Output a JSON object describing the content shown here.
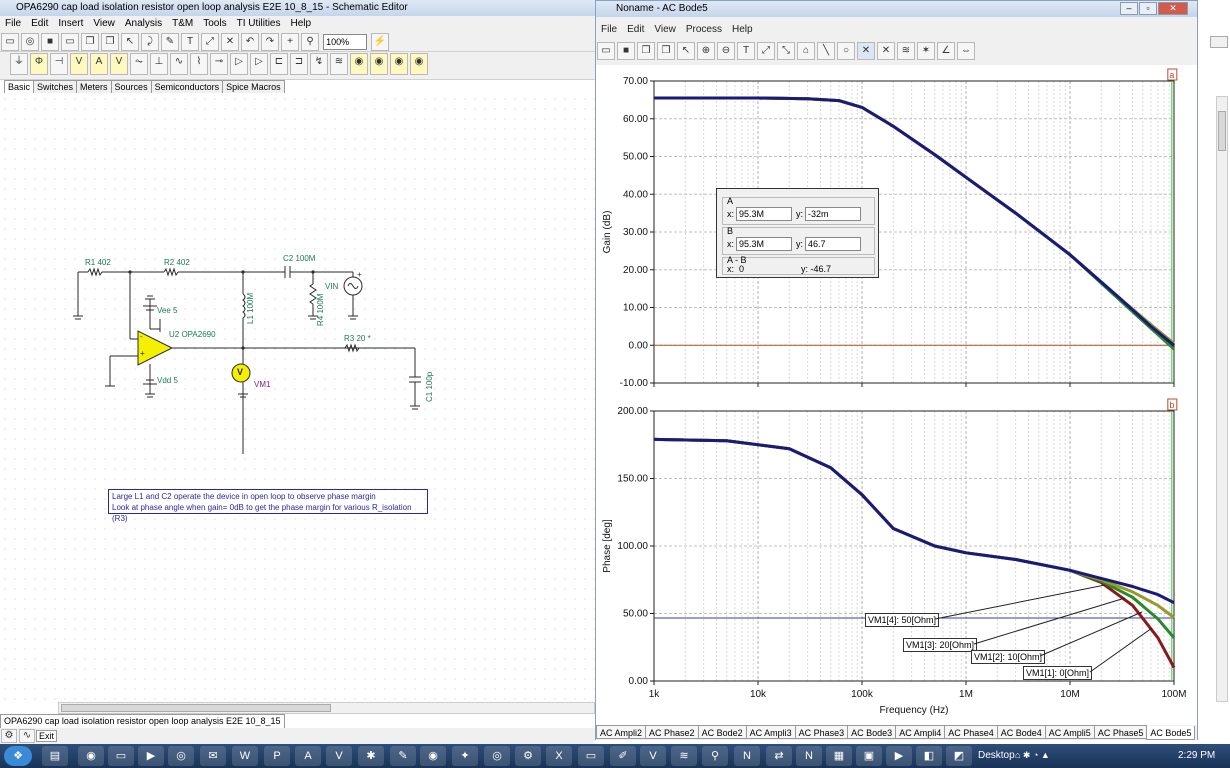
{
  "schematic": {
    "title": "OPA6290 cap load isolation resistor open loop analysis E2E 10_8_15 - Schematic Editor",
    "menu": [
      "File",
      "Edit",
      "Insert",
      "View",
      "Analysis",
      "T&M",
      "Tools",
      "TI Utilities",
      "Help"
    ],
    "zoom": "100%",
    "component_tabs": [
      "Basic",
      "Switches",
      "Meters",
      "Sources",
      "Semiconductors",
      "Spice Macros"
    ],
    "labels": {
      "r1": "R1 402",
      "r2": "R2 402",
      "c2": "C2 100M",
      "vin": "VIN",
      "l1": "L1 100M",
      "r4": "R4 100M",
      "vee": "Vee 5",
      "vdd": "Vdd 5",
      "u2": "U2 OPA2690",
      "r3": "R3 20 *",
      "c1": "C1 100p",
      "vm1": "VM1",
      "v_symbol": "V",
      "plus": "+",
      "minus": "-"
    },
    "note_line1": "Large L1 and C2 operate the device in open loop to observe phase margin",
    "note_line2": "Look at phase angle when gain= 0dB to get the phase margin for various R_isolation (R3)",
    "status_tab": "OPA6290 cap load isolation resistor open loop analysis E2E 10_8_15",
    "exit_label": "Exit"
  },
  "bode": {
    "title": "Noname - AC Bode5",
    "menu": [
      "File",
      "Edit",
      "View",
      "Process",
      "Help"
    ],
    "marker_a": "a",
    "marker_b": "b",
    "cursor": {
      "a_label": "A",
      "a_x": "95.3M",
      "a_y": "-32m",
      "b_label": "B",
      "b_x": "95.3M",
      "b_y": "46.7",
      "diff_label": "A - B",
      "diff_x": "0",
      "diff_y": "y: -46.7",
      "x_prefix": "x:",
      "y_prefix": "y:"
    },
    "legend": [
      "VM1[4]: 50[Ohm]",
      "VM1[3]: 20[Ohm]",
      "VM1[2]: 10[Ohm]",
      "VM1[1]: 0[Ohm]"
    ],
    "tabs": [
      "AC Ampli2",
      "AC Phase2",
      "AC Bode2",
      "AC Ampli3",
      "AC Phase3",
      "AC Bode3",
      "AC Ampli4",
      "AC Phase4",
      "AC Bode4",
      "AC Ampli5",
      "AC Phase5",
      "AC Bode5"
    ]
  },
  "taskbar": {
    "desktop_label": "Desktop",
    "clock": "2:29 PM"
  },
  "chart_data": [
    {
      "type": "line",
      "xscale": "log",
      "xlabel": "Frequency (Hz)",
      "ylabel": "Gain (dB)",
      "xlim": [
        1000,
        100000000
      ],
      "ylim": [
        -10,
        70
      ],
      "x_ticks": [
        "1k",
        "10k",
        "100k",
        "1M",
        "10M",
        "100M"
      ],
      "y_ticks": [
        "70.00",
        "60.00",
        "50.00",
        "40.00",
        "30.00",
        "20.00",
        "10.00",
        "0.00",
        "-10.00"
      ],
      "x": [
        1000,
        10000,
        30000,
        60000,
        100000,
        200000,
        500000,
        1000000,
        3000000,
        10000000,
        30000000,
        60000000,
        100000000
      ],
      "series": [
        {
          "name": "VM1[4]: 50[Ohm]",
          "color": "#1a1a7a",
          "values": [
            65.5,
            65.5,
            65.3,
            64.8,
            63.0,
            58.0,
            50.5,
            44.5,
            35.0,
            24.0,
            12.5,
            5.0,
            0.0
          ]
        },
        {
          "name": "VM1[3]: 20[Ohm]",
          "color": "#9a9a2a",
          "values": [
            65.5,
            65.5,
            65.3,
            64.8,
            63.0,
            58.0,
            50.5,
            44.5,
            35.0,
            24.0,
            12.5,
            5.5,
            0.5
          ]
        },
        {
          "name": "VM1[2]: 10[Ohm]",
          "color": "#2a8a2a",
          "values": [
            65.5,
            65.5,
            65.3,
            64.8,
            63.0,
            58.0,
            50.5,
            44.5,
            35.0,
            24.0,
            12.0,
            4.5,
            -1.0
          ]
        },
        {
          "name": "VM1[1]: 0[Ohm]",
          "color": "#8a1a1a",
          "values": [
            65.5,
            65.5,
            65.3,
            64.8,
            63.0,
            58.0,
            50.5,
            44.5,
            35.0,
            24.0,
            12.5,
            5.0,
            -0.5
          ]
        }
      ]
    },
    {
      "type": "line",
      "xscale": "log",
      "xlabel": "Frequency (Hz)",
      "ylabel": "Phase [deg]",
      "xlim": [
        1000,
        100000000
      ],
      "ylim": [
        0,
        200
      ],
      "x_ticks": [
        "1k",
        "10k",
        "100k",
        "1M",
        "10M",
        "100M"
      ],
      "y_ticks": [
        "200.00",
        "150.00",
        "100.00",
        "50.00",
        "0.00"
      ],
      "hline": 46.7,
      "x": [
        1000,
        5000,
        20000,
        50000,
        100000,
        200000,
        500000,
        1000000,
        3000000,
        10000000,
        20000000,
        40000000,
        70000000,
        100000000
      ],
      "series": [
        {
          "name": "VM1[4]: 50[Ohm]",
          "color": "#1a1a7a",
          "values": [
            179,
            178,
            172,
            158,
            138,
            113,
            100,
            95,
            90,
            82,
            76,
            70,
            64,
            58
          ]
        },
        {
          "name": "VM1[3]: 20[Ohm]",
          "color": "#9a9a2a",
          "values": [
            179,
            178,
            172,
            158,
            138,
            113,
            100,
            95,
            90,
            82,
            75,
            66,
            56,
            47
          ]
        },
        {
          "name": "VM1[2]: 10[Ohm]",
          "color": "#2a8a2a",
          "values": [
            179,
            178,
            172,
            158,
            138,
            113,
            100,
            95,
            90,
            82,
            74,
            62,
            46,
            32
          ]
        },
        {
          "name": "VM1[1]: 0[Ohm]",
          "color": "#8a1a1a",
          "values": [
            179,
            178,
            172,
            158,
            138,
            113,
            100,
            95,
            90,
            82,
            73,
            56,
            32,
            10
          ]
        }
      ]
    }
  ]
}
